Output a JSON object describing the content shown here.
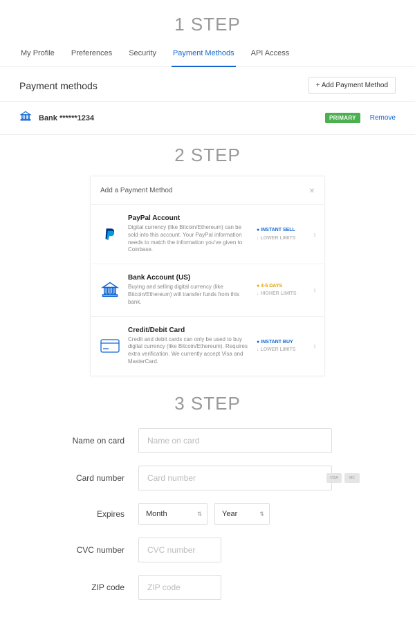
{
  "step1": {
    "heading": "1 STEP",
    "tabs": [
      "My Profile",
      "Preferences",
      "Security",
      "Payment Methods",
      "API Access"
    ],
    "active_tab_index": 3,
    "section_title": "Payment methods",
    "add_button": "+ Add Payment Method",
    "method": {
      "name": "Bank ******1234",
      "badge": "PRIMARY",
      "remove": "Remove"
    }
  },
  "step2": {
    "heading": "2 STEP",
    "modal_title": "Add a Payment Method",
    "options": [
      {
        "title": "PayPal Account",
        "desc": "Digital currency (like Bitcoin/Ethereum) can be sold into this account. Your PayPal information needs to match the information you've given to Coinbase.",
        "tag1": "INSTANT SELL",
        "tag1_class": "tag-inst",
        "tag2": "LOWER LIMITS",
        "tag2_class": "tag-low",
        "icon": "paypal"
      },
      {
        "title": "Bank Account (US)",
        "desc": "Buying and selling digital currency (like Bitcoin/Ethereum) will transfer funds from this bank.",
        "tag1": "4-5 DAYS",
        "tag1_class": "tag-days",
        "tag2": "HIGHER LIMITS",
        "tag2_class": "tag-high",
        "icon": "bank"
      },
      {
        "title": "Credit/Debit Card",
        "desc": "Credit and debit cards can only be used to buy digital currency (like Bitcoin/Ethereum). Requires extra verification. We currently accept Visa and MasterCard.",
        "tag1": "INSTANT BUY",
        "tag1_class": "tag-inst",
        "tag2": "LOWER LIMITS",
        "tag2_class": "tag-low",
        "icon": "card"
      }
    ]
  },
  "step3": {
    "heading": "3 STEP",
    "fields": {
      "name_label": "Name on card",
      "name_placeholder": "Name on card",
      "number_label": "Card number",
      "number_placeholder": "Card number",
      "expires_label": "Expires",
      "month": "Month",
      "year": "Year",
      "cvc_label": "CVC number",
      "cvc_placeholder": "CVC number",
      "zip_label": "ZIP code",
      "zip_placeholder": "ZIP code"
    }
  }
}
